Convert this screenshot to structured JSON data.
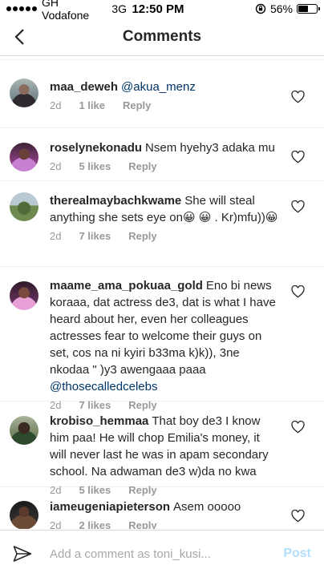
{
  "status": {
    "carrier": "GH Vodafone",
    "network": "3G",
    "time": "12:50 PM",
    "battery": "56%",
    "battery_level": 0.56
  },
  "nav": {
    "title": "Comments",
    "back_icon": "chevron-left-icon"
  },
  "comments": [
    {
      "username": "maa_deweh",
      "text": "",
      "mention": "@akua_menz",
      "age": "2d",
      "likes": "1 like",
      "reply": "Reply"
    },
    {
      "username": "roselynekonadu",
      "text": "Nsem hyehy3 adaka mu",
      "age": "2d",
      "likes": "5 likes",
      "reply": "Reply"
    },
    {
      "username": "therealmaybachkwame",
      "text": "She will steal anything she sets eye on😀 😀 . Kr)mfu))😀",
      "age": "2d",
      "likes": "7 likes",
      "reply": "Reply"
    },
    {
      "username": "maame_ama_pokuaa_gold",
      "text": "Eno bi news koraaa, dat actress de3, dat is what I have heard about her, even her colleagues actresses fear to welcome their guys on set, cos na ni kyiri b33ma k)k)), 3ne nkodaa \" )y3 awengaaa paaa",
      "mention": "@thosecalledcelebs",
      "age": "2d",
      "likes": "7 likes",
      "reply": "Reply"
    },
    {
      "username": "krobiso_hemmaa",
      "text": "That boy de3 I know him paa! He will chop Emilia's money, it will never last he was in apam secondary school. Na adwaman de3 w)da no kwa",
      "age": "2d",
      "likes": "5 likes",
      "reply": "Reply"
    },
    {
      "username": "iameugeniapieterson",
      "text": "Asem ooooo",
      "age": "2d",
      "likes": "2 likes",
      "reply": "Reply"
    }
  ],
  "composer": {
    "placeholder": "Add a comment as toni_kusi...",
    "post_label": "Post",
    "send_icon": "paper-plane-icon"
  },
  "colors": {
    "mention": "#003569",
    "meta": "#999999",
    "post_disabled": "#b2dffc"
  }
}
